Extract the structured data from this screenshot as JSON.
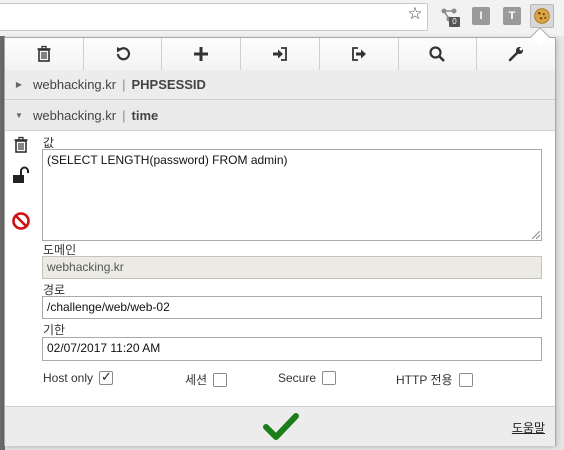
{
  "browser": {
    "extension_badge": "0",
    "ext_b_label": "I",
    "ext_c_label": "T"
  },
  "toolbar": {
    "buttons": [
      {
        "icon": "trash-icon"
      },
      {
        "icon": "undo-icon"
      },
      {
        "icon": "plus-icon"
      },
      {
        "icon": "import-icon"
      },
      {
        "icon": "export-icon"
      },
      {
        "icon": "search-icon"
      },
      {
        "icon": "wrench-icon"
      }
    ]
  },
  "cookies": [
    {
      "domain": "webhacking.kr",
      "separator": "|",
      "name": "PHPSESSID",
      "expanded": false
    },
    {
      "domain": "webhacking.kr",
      "separator": "|",
      "name": "time",
      "expanded": true
    }
  ],
  "editor": {
    "value_label": "값",
    "value": "(SELECT LENGTH(password) FROM admin)",
    "domain_label": "도메인",
    "domain": "webhacking.kr",
    "path_label": "경로",
    "path": "/challenge/web/web-02",
    "expiry_label": "기한",
    "expiry": "02/07/2017 11:20 AM",
    "options": {
      "host_only": {
        "label": "Host only",
        "checked": true
      },
      "session": {
        "label": "세션",
        "checked": false
      },
      "secure": {
        "label": "Secure",
        "checked": false
      },
      "http_only": {
        "label": "HTTP 전용",
        "checked": false
      }
    }
  },
  "footer": {
    "help_label": "도움말"
  },
  "colors": {
    "accent_check": "#1a7f1a",
    "block_red": "#d01010"
  }
}
